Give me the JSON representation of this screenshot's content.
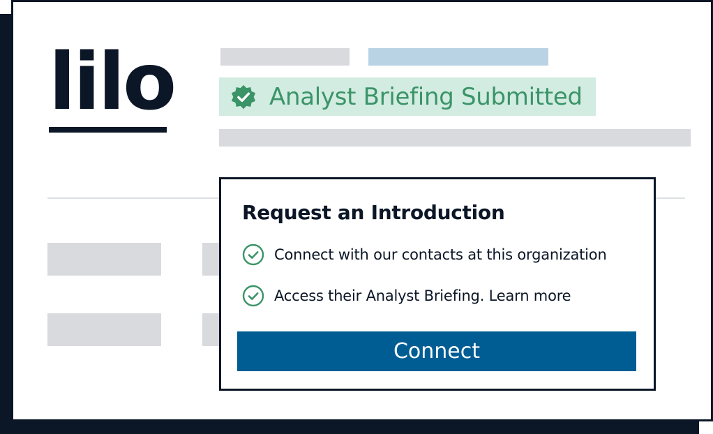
{
  "logo": {
    "text": "lilo"
  },
  "badge": {
    "text": "Analyst Briefing Submitted",
    "icon": "verified-badge-icon"
  },
  "modal": {
    "title": "Request an Introduction",
    "items": [
      {
        "icon": "check-circle-icon",
        "text": "Connect with our contacts at this organization"
      },
      {
        "icon": "check-circle-icon",
        "text": "Access their Analyst Briefing. Learn more"
      }
    ],
    "button_label": "Connect"
  },
  "colors": {
    "navy": "#0b1626",
    "green": "#3a9468",
    "badge_bg": "#d3ece1",
    "button": "#005d93",
    "placeholder_gray": "#d8dadd",
    "placeholder_blue": "#b9d3e4"
  }
}
